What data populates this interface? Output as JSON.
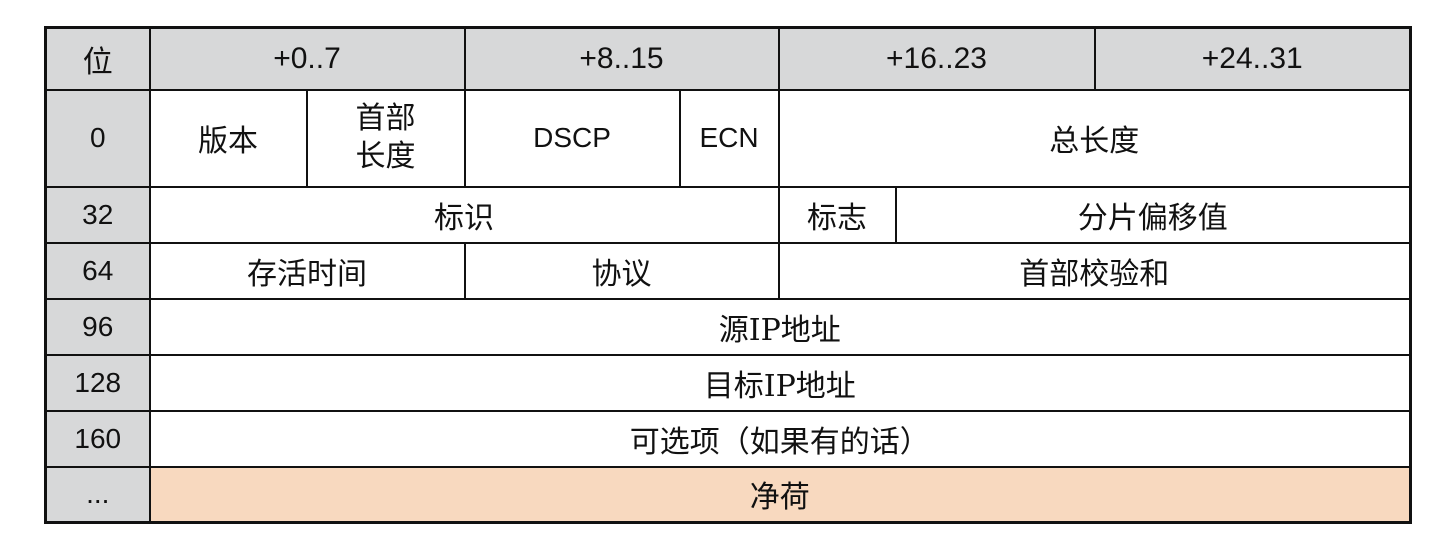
{
  "header": {
    "bit": "位",
    "cols": [
      "+0..7",
      "+8..15",
      "+16..23",
      "+24..31"
    ]
  },
  "rows": {
    "r0": {
      "offset": "0",
      "version": "版本",
      "ihl_line1": "首部",
      "ihl_line2": "长度",
      "dscp": "DSCP",
      "ecn": "ECN",
      "total_length": "总长度"
    },
    "r32": {
      "offset": "32",
      "identification": "标识",
      "flags": "标志",
      "fragment_offset": "分片偏移值"
    },
    "r64": {
      "offset": "64",
      "ttl": "存活时间",
      "protocol": "协议",
      "checksum": "首部校验和"
    },
    "r96": {
      "offset": "96",
      "source_ip": "源IP地址"
    },
    "r128": {
      "offset": "128",
      "dest_ip": "目标IP地址"
    },
    "r160": {
      "offset": "160",
      "options": "可选项（如果有的话）"
    },
    "rdots": {
      "offset": "...",
      "payload": "净荷"
    }
  },
  "colors": {
    "header_bg": "#d7d8d9",
    "payload_bg": "#f8d9bf",
    "border": "#111111"
  }
}
